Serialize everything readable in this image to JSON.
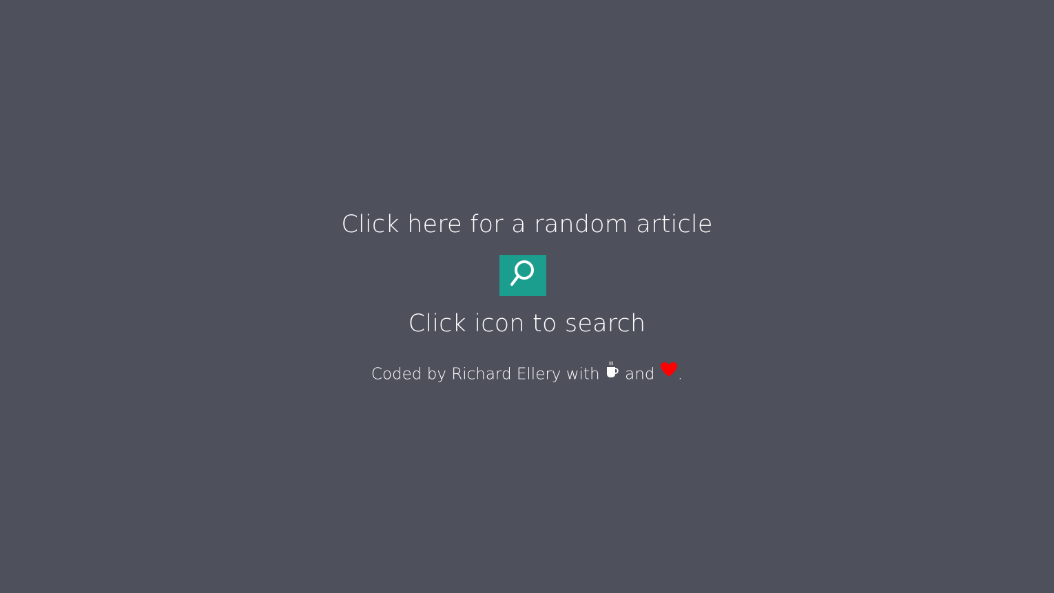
{
  "random_article": {
    "label": "Click here for a random article"
  },
  "search": {
    "icon": "search-icon",
    "button_color": "#1c9e8f",
    "hint": "Click icon to search"
  },
  "footer": {
    "prefix": "Coded by Richard Ellery with",
    "middle": "and",
    "suffix": ".",
    "icons": [
      "coffee-icon",
      "heart-icon"
    ],
    "heart_color": "#ff0000"
  },
  "background_color": "#4e505b"
}
